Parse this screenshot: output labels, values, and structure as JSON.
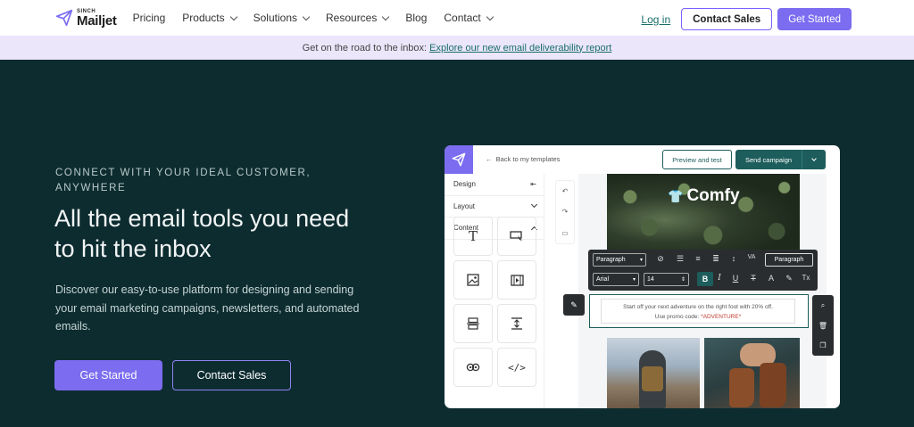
{
  "nav": {
    "logo_brand": "SINCH",
    "logo_name": "Mailjet",
    "links": [
      "Pricing",
      "Products",
      "Solutions",
      "Resources",
      "Blog",
      "Contact"
    ],
    "login": "Log in",
    "contact_sales": "Contact Sales",
    "get_started": "Get Started"
  },
  "banner": {
    "text": "Get on the road to the inbox:",
    "link": "Explore our new email deliverability report"
  },
  "hero": {
    "eyebrow": "CONNECT WITH YOUR IDEAL CUSTOMER, ANYWHERE",
    "headline": "All the email tools you need to hit the inbox",
    "subtext": "Discover our easy-to-use platform for designing and sending your email marketing campaigns, newsletters, and automated emails.",
    "primary_button": "Get Started",
    "secondary_button": "Contact Sales"
  },
  "editor": {
    "back_link": "Back to my templates",
    "preview_button": "Preview and test",
    "send_button": "Send campaign",
    "sidebar": [
      "Design",
      "Layout",
      "Content"
    ],
    "tiles": [
      "text-icon",
      "button-icon",
      "image-icon",
      "video-icon",
      "divider-icon",
      "spacer-icon",
      "social-icon",
      "code-icon"
    ],
    "email_brand": "Comfy",
    "toolbar": {
      "block_style": "Paragraph",
      "font": "Arial",
      "size": "14",
      "paragraph_button": "Paragraph",
      "clear_format": "Tx"
    },
    "text_line1": "Start off your next adventure on the right foot with 20% off.",
    "text_line2": "Use promo code:",
    "promo_code": "*ADVENTURE*"
  },
  "colors": {
    "background": "#0d2c30",
    "accent": "#7b6cf0",
    "teal": "#1d5d5b",
    "banner": "#ebe6fa"
  }
}
